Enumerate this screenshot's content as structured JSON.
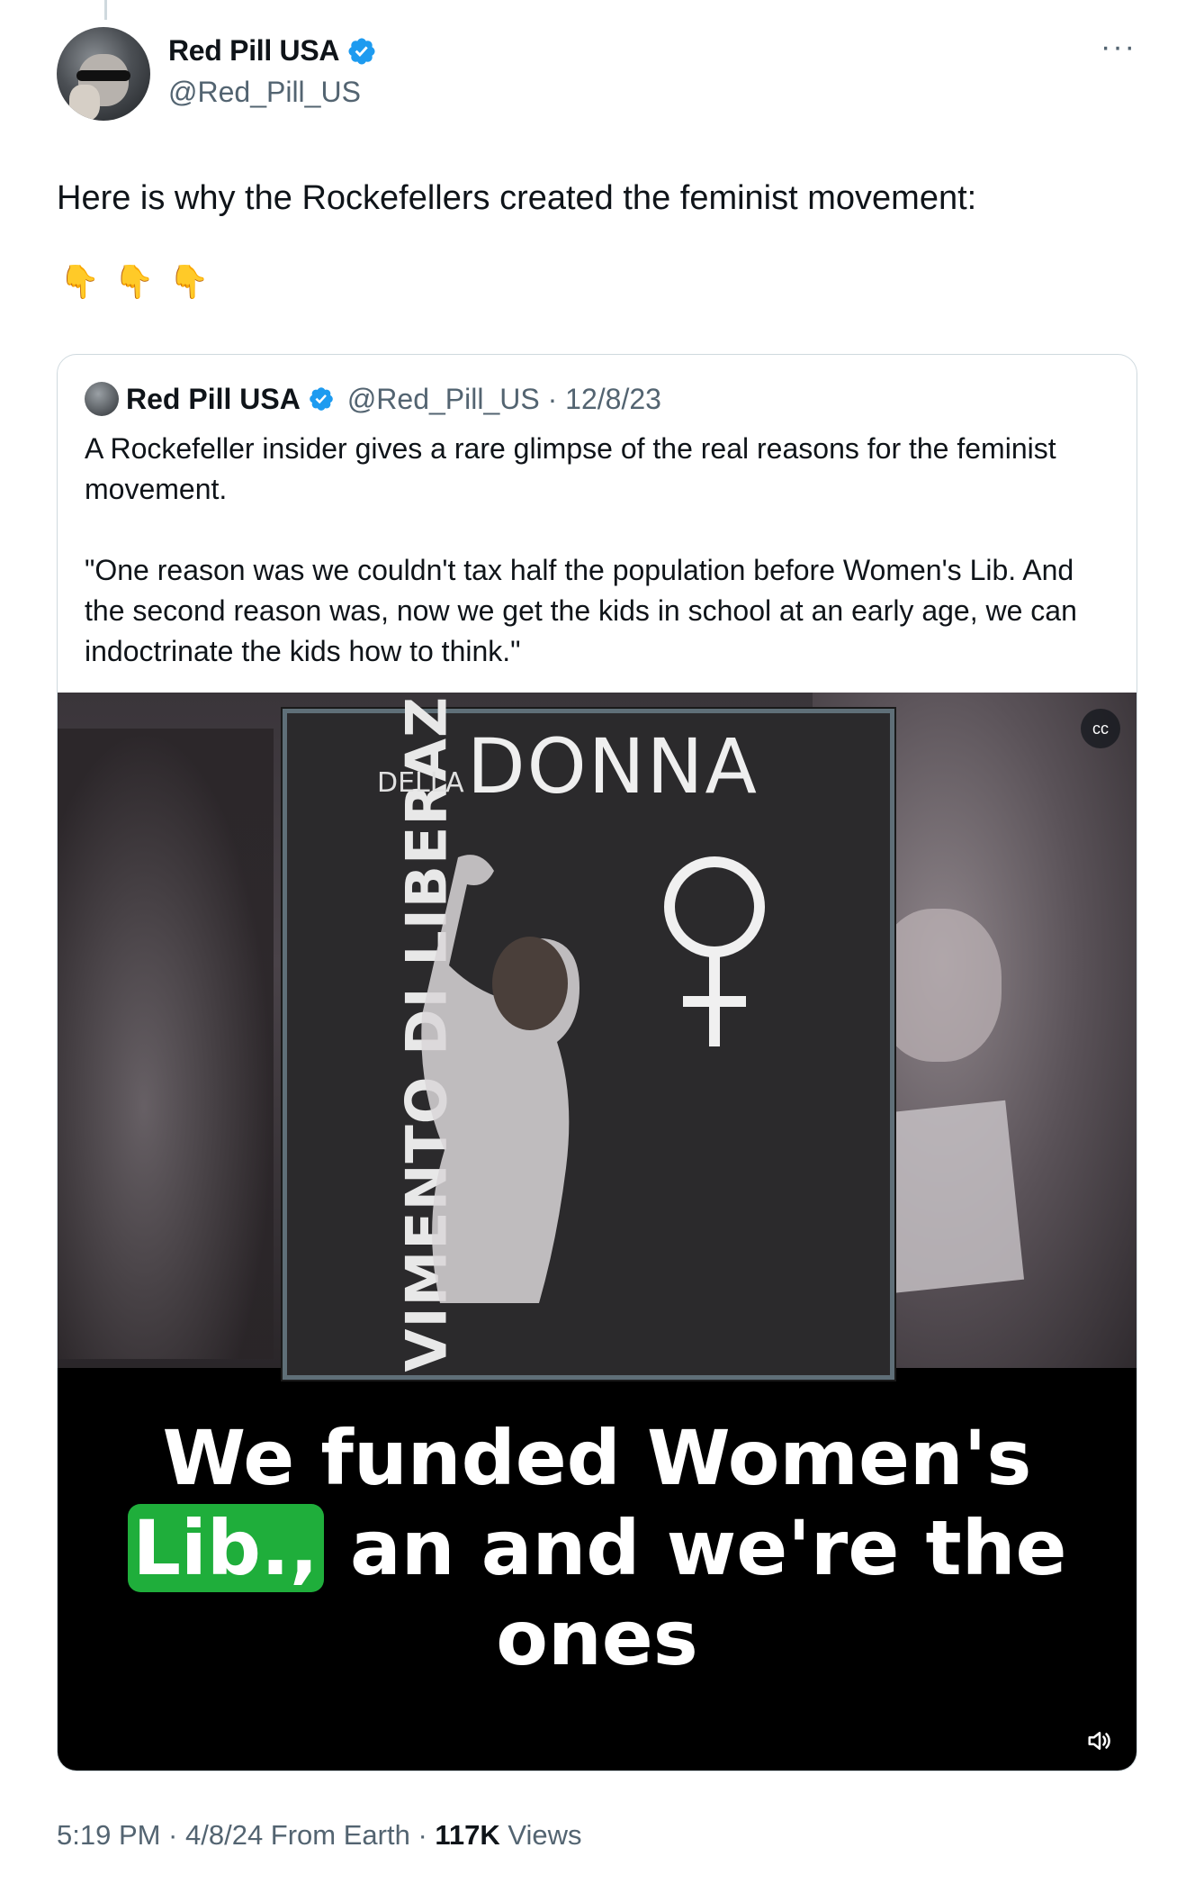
{
  "author": {
    "name": "Red Pill USA",
    "handle": "@Red_Pill_US"
  },
  "more_label": "···",
  "tweet": {
    "text": "Here is why the Rockefellers created the feminist movement:",
    "emojis": [
      "👇",
      "👇",
      "👇"
    ]
  },
  "quoted": {
    "name": "Red Pill USA",
    "handle_date": "@Red_Pill_US · 12/8/23",
    "text": "A Rockefeller insider gives a rare glimpse of the real reasons for the feminist movement.\n\n\"One reason was we couldn't tax half the population before Women's Lib. And the second reason was, now we get the kids in school at an early age, we can indoctrinate the kids how to think.\""
  },
  "video": {
    "poster_vertical_text": "VIMENTO DI LIBERAZIONE",
    "poster_della": "DELLA",
    "poster_title": "DONNA",
    "caption_line1": "We funded Women's",
    "caption_highlight": "Lib.,",
    "caption_line2_rest": " an and we're the",
    "caption_line3": "ones",
    "cc_label": "cc"
  },
  "footer": {
    "time_date": "5:19 PM · 4/8/24 From Earth · ",
    "views_count": "117K",
    "views_label": " Views"
  },
  "colors": {
    "accent": "#1d9bf0",
    "muted": "#536471",
    "caption_highlight": "#1fae3b"
  }
}
